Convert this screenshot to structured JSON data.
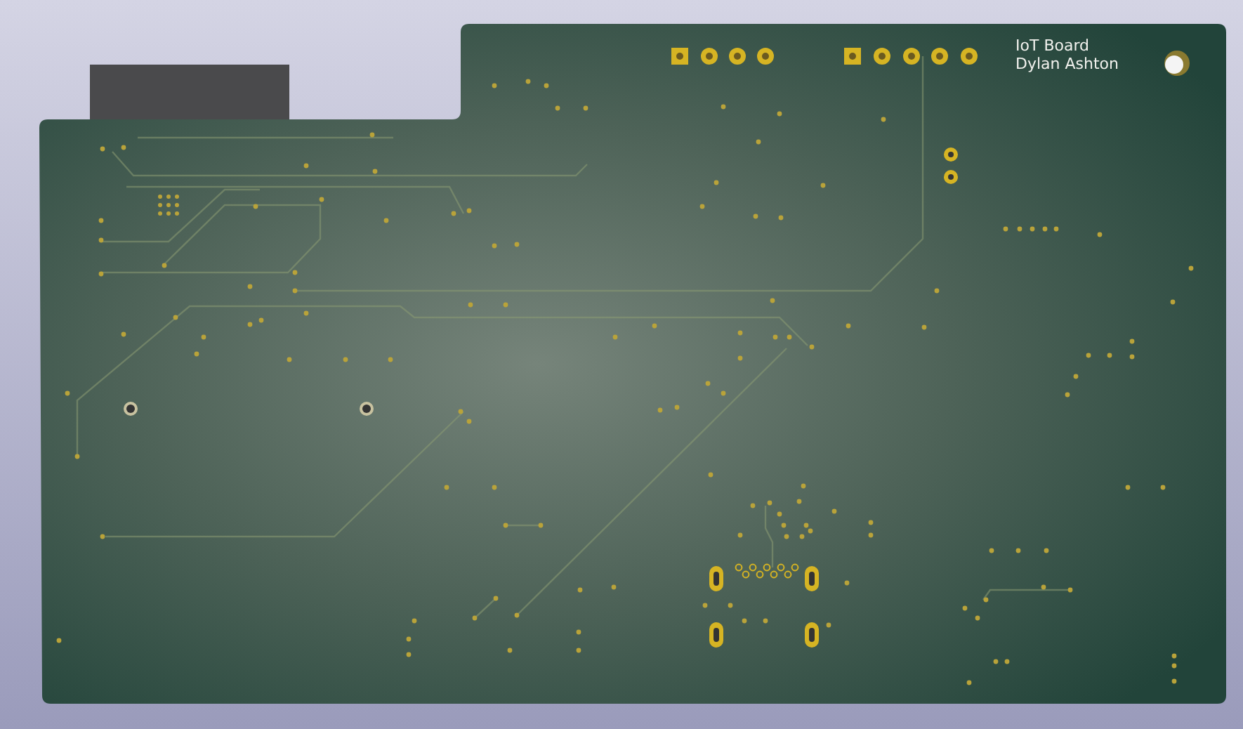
{
  "board": {
    "silkscreen": [
      "IoT Board",
      "Dylan Ashton"
    ]
  }
}
